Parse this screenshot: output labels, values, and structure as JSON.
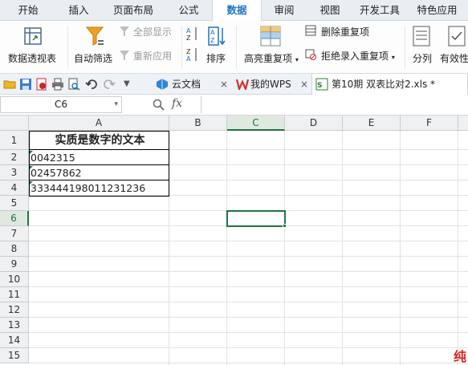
{
  "menu": {
    "tabs": [
      "开始",
      "插入",
      "页面布局",
      "公式",
      "数据",
      "审阅",
      "视图",
      "开发工具",
      "特色应用"
    ],
    "active": "数据"
  },
  "ribbon": {
    "pivot_table": "数据透视表",
    "auto_filter": "自动筛选",
    "show_all": "全部显示",
    "reapply": "重新应用",
    "sort": "排序",
    "highlight_duplicates": "高亮重复项",
    "remove_duplicates": "删除重复项",
    "reject_duplicates": "拒绝录入重复项",
    "text_to_columns": "分列",
    "validity": "有效性"
  },
  "quick_access": {
    "cloud_docs": "云文档",
    "my_wps": "我的WPS",
    "active_file": "第10期 双表比对2.xls *"
  },
  "formula_bar": {
    "name_box": "C6",
    "fx_label": "fx",
    "formula": ""
  },
  "sheet": {
    "columns": [
      "A",
      "B",
      "C",
      "D",
      "E",
      "F"
    ],
    "rows": [
      "1",
      "2",
      "3",
      "4",
      "5",
      "6",
      "7",
      "8",
      "9",
      "10",
      "11",
      "12",
      "13",
      "14",
      "15"
    ],
    "selected_cell": "C6",
    "cells": {
      "A1": "实质是数字的文本",
      "A2": "0042315",
      "A3": "02457862",
      "A4": "333444198011231236"
    }
  },
  "watermark": "纯",
  "colors": {
    "accent": "#217346",
    "menu_active": "#1a73c8",
    "filter_icon": "#f0a020",
    "watermark": "#e02020"
  }
}
